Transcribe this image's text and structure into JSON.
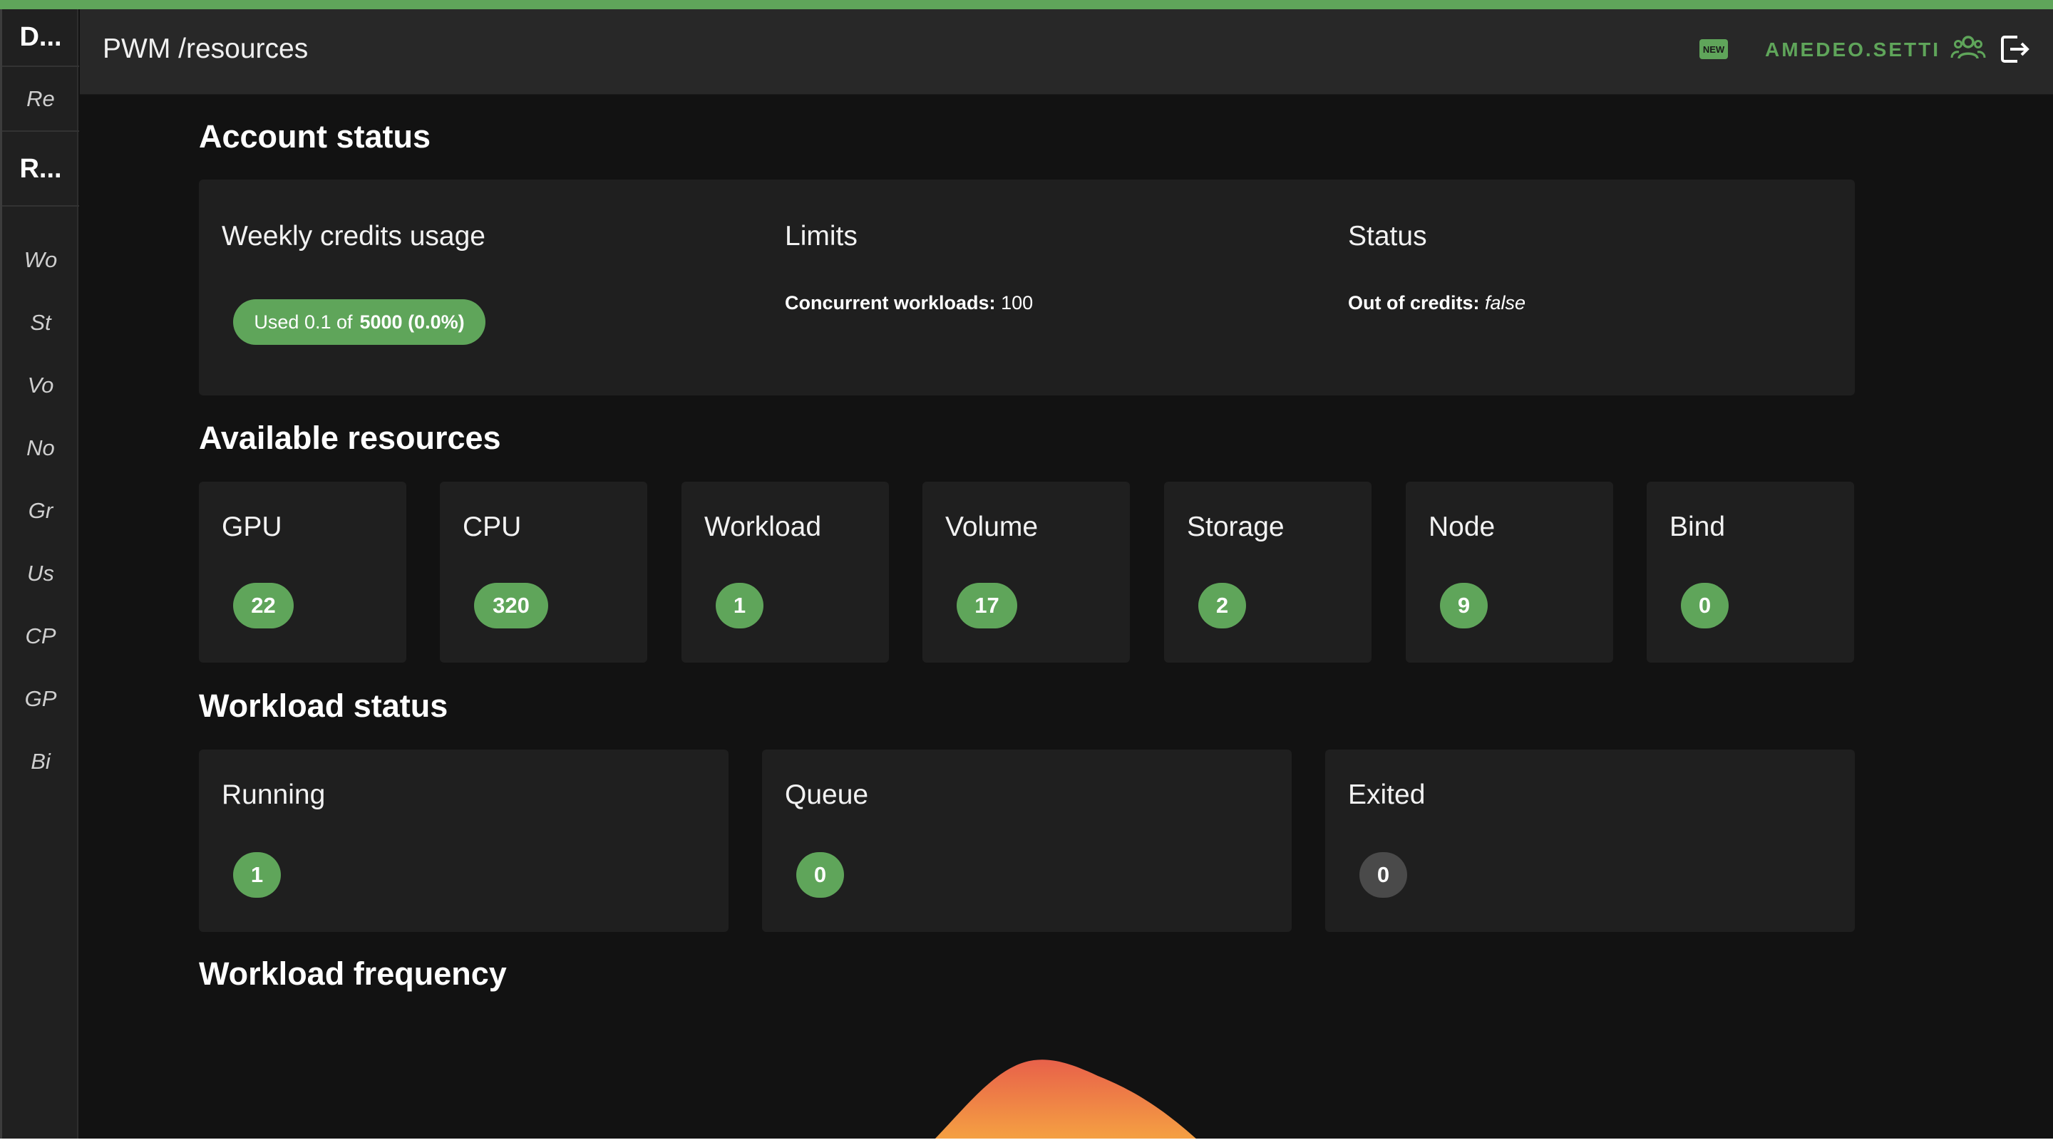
{
  "sidebar": {
    "header_1": "D...",
    "item_1": "Re",
    "header_2": "R...",
    "items": [
      "Wo",
      "St",
      "Vo",
      "No",
      "Gr",
      "Us",
      "CP",
      "GP",
      "Bi"
    ]
  },
  "header": {
    "title": "PWM /resources",
    "new_icon": "new-badge-icon",
    "user": "AMEDEO.SETTI",
    "user_icon": "group-icon",
    "logout_icon": "logout-icon"
  },
  "account_status": {
    "title": "Account status",
    "weekly": {
      "title": "Weekly credits usage",
      "used_prefix": "Used 0.1 of",
      "used_total": "5000 (0.0%)"
    },
    "limits": {
      "title": "Limits",
      "label": "Concurrent workloads:",
      "value": "100"
    },
    "status": {
      "title": "Status",
      "label": "Out of credits:",
      "value": "false"
    }
  },
  "available_resources": {
    "title": "Available resources",
    "cards": [
      {
        "label": "GPU",
        "count": "22"
      },
      {
        "label": "CPU",
        "count": "320"
      },
      {
        "label": "Workload",
        "count": "1"
      },
      {
        "label": "Volume",
        "count": "17"
      },
      {
        "label": "Storage",
        "count": "2"
      },
      {
        "label": "Node",
        "count": "9"
      },
      {
        "label": "Bind",
        "count": "0"
      }
    ]
  },
  "workload_status": {
    "title": "Workload status",
    "cards": [
      {
        "label": "Running",
        "count": "1"
      },
      {
        "label": "Queue",
        "count": "0"
      },
      {
        "label": "Exited",
        "count": "0"
      }
    ]
  },
  "workload_frequency": {
    "title": "Workload frequency"
  },
  "colors": {
    "accent": "#5fa55a",
    "background": "#121212",
    "card": "#1f1f1f",
    "chart_top": "#e8614a",
    "chart_bottom": "#f5a142"
  }
}
